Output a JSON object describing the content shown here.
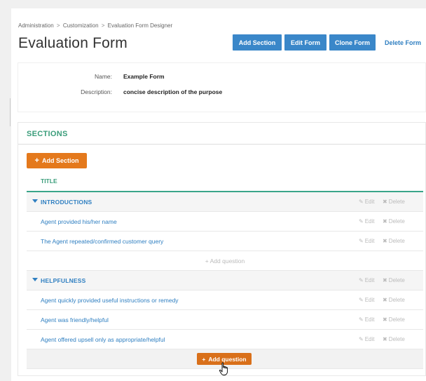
{
  "breadcrumb": {
    "items": [
      "Administration",
      "Customization",
      "Evaluation Form Designer"
    ],
    "separator": ">"
  },
  "header": {
    "title": "Evaluation Form",
    "buttons": {
      "add_section": "Add Section",
      "edit_form": "Edit Form",
      "clone_form": "Clone Form",
      "delete_form": "Delete Form"
    }
  },
  "form_info": {
    "name_label": "Name:",
    "name_value": "Example Form",
    "description_label": "Description:",
    "description_value": "concise description of the purpose"
  },
  "sections_panel": {
    "heading": "SECTIONS",
    "add_section_label": "Add Section",
    "add_section_plus": "+",
    "column_title": "TITLE",
    "edit_label": "Edit",
    "delete_label": "Delete",
    "add_question_label": "Add question",
    "add_question_plus": "+",
    "sections": [
      {
        "name": "INTRODUCTIONS",
        "questions": [
          "Agent provided his/her name",
          "The Agent repeated/confirmed customer query"
        ]
      },
      {
        "name": "HELPFULNESS",
        "questions": [
          "Agent quickly provided useful instructions or remedy",
          "Agent was friendly/helpful",
          "Agent offered upsell only as appropriate/helpful"
        ]
      }
    ]
  },
  "colors": {
    "primary_button": "#3a87c9",
    "link": "#2f7fc1",
    "accent_green": "#3a9d7a",
    "orange_button": "#e4791c",
    "muted_action": "#bbbbbb"
  }
}
